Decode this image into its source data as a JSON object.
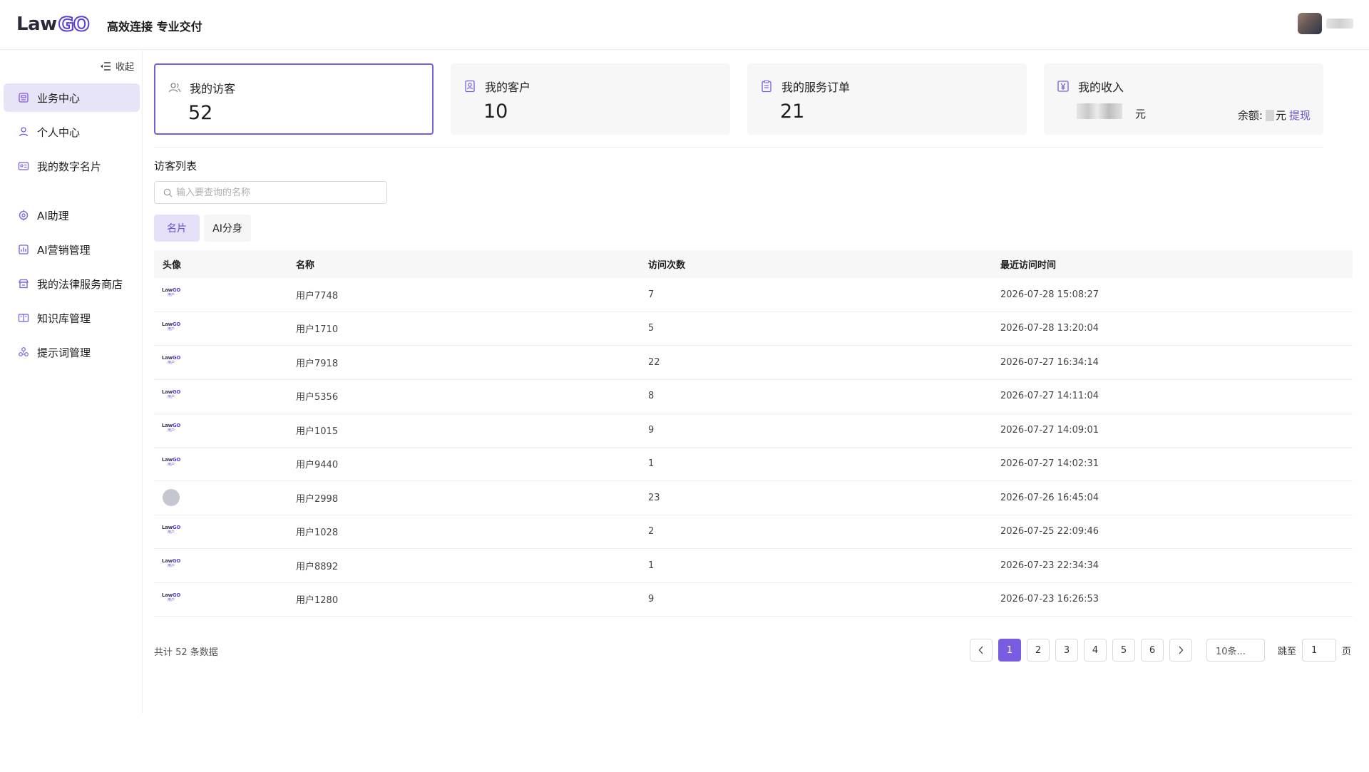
{
  "header": {
    "logo_law": "Law",
    "logo_go": "GO",
    "slogan": "高效连接 专业交付"
  },
  "sidebar": {
    "collapse_label": "收起",
    "items": [
      {
        "label": "业务中心",
        "icon": "business-icon",
        "active": true
      },
      {
        "label": "个人中心",
        "icon": "user-icon"
      },
      {
        "label": "我的数字名片",
        "icon": "card-icon"
      },
      {
        "label": "AI助理",
        "icon": "ai-icon"
      },
      {
        "label": "AI营销管理",
        "icon": "chart-icon"
      },
      {
        "label": "我的法律服务商店",
        "icon": "store-icon"
      },
      {
        "label": "知识库管理",
        "icon": "book-icon"
      },
      {
        "label": "提示词管理",
        "icon": "prompt-icon"
      }
    ]
  },
  "stats": [
    {
      "label": "我的访客",
      "value": "52"
    },
    {
      "label": "我的客户",
      "value": "10"
    },
    {
      "label": "我的服务订单",
      "value": "21"
    },
    {
      "label": "我的收入",
      "unit": "元",
      "balance_label": "余额:",
      "balance_unit": "元",
      "withdraw": "提现"
    }
  ],
  "visitor_list": {
    "title": "访客列表",
    "search_placeholder": "输入要查询的名称",
    "tabs": [
      "名片",
      "AI分身"
    ],
    "columns": [
      "头像",
      "名称",
      "访问次数",
      "最近访问时间"
    ],
    "rows": [
      {
        "avatar": "logo",
        "name": "用户7748",
        "visits": "7",
        "last": "2026-07-28 15:08:27"
      },
      {
        "avatar": "logo",
        "name": "用户1710",
        "visits": "5",
        "last": "2026-07-28 13:20:04"
      },
      {
        "avatar": "logo",
        "name": "用户7918",
        "visits": "22",
        "last": "2026-07-27 16:34:14"
      },
      {
        "avatar": "logo",
        "name": "用户5356",
        "visits": "8",
        "last": "2026-07-27 14:11:04"
      },
      {
        "avatar": "logo",
        "name": "用户1015",
        "visits": "9",
        "last": "2026-07-27 14:09:01"
      },
      {
        "avatar": "logo",
        "name": "用户9440",
        "visits": "1",
        "last": "2026-07-27 14:02:31"
      },
      {
        "avatar": "gray",
        "name": "用户2998",
        "visits": "23",
        "last": "2026-07-26 16:45:04"
      },
      {
        "avatar": "logo",
        "name": "用户1028",
        "visits": "2",
        "last": "2026-07-25 22:09:46"
      },
      {
        "avatar": "logo",
        "name": "用户8892",
        "visits": "1",
        "last": "2026-07-23 22:34:34"
      },
      {
        "avatar": "logo",
        "name": "用户1280",
        "visits": "9",
        "last": "2026-07-23 16:26:53"
      }
    ],
    "mini_logo_top_a": "Law",
    "mini_logo_top_b": "GO",
    "mini_logo_bottom": "用户"
  },
  "pagination": {
    "total": "共计 52 条数据",
    "pages": [
      "1",
      "2",
      "3",
      "4",
      "5",
      "6"
    ],
    "current": "1",
    "page_size": "10条...",
    "jump_label": "跳至",
    "jump_value": "1",
    "page_suffix": "页"
  },
  "colors": {
    "accent": "#7a5ce0",
    "accent_light": "#e8e4f8"
  }
}
